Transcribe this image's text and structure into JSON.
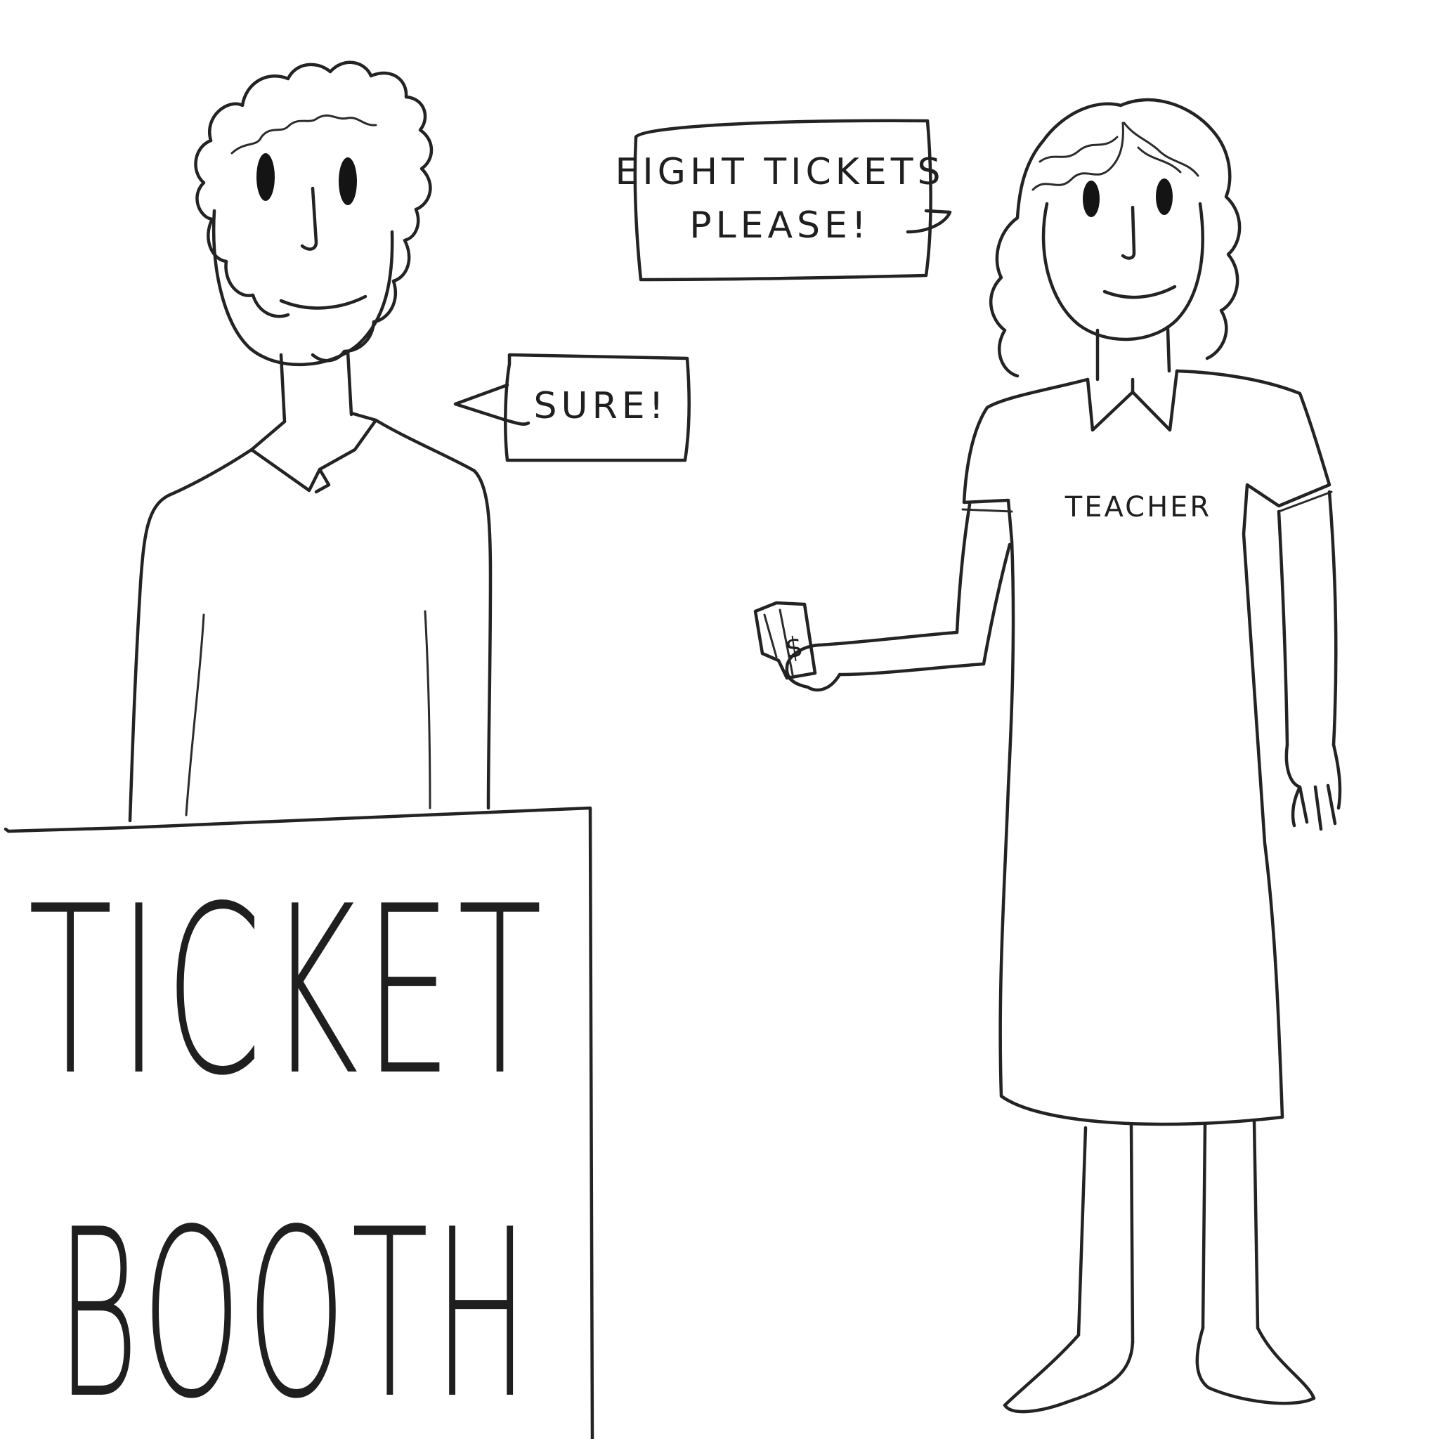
{
  "speech": {
    "teacher": {
      "line1": "EIGHT TICKETS",
      "line2": "PLEASE!"
    },
    "seller": {
      "text": "SURE!"
    }
  },
  "teacher_shirt": {
    "label": "TEACHER"
  },
  "booth_sign": {
    "line1": "TICKET",
    "line2": "BOOTH"
  },
  "money": {
    "symbol": "$"
  }
}
